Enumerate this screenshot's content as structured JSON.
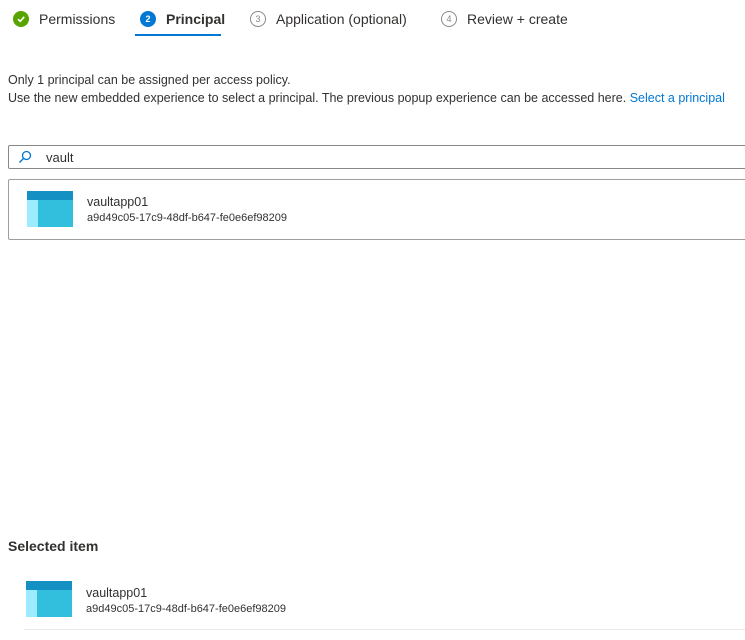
{
  "wizard": {
    "steps": [
      {
        "number": "",
        "label": "Permissions",
        "state": "completed",
        "icon": "checkmark-icon"
      },
      {
        "number": "2",
        "label": "Principal",
        "state": "active"
      },
      {
        "number": "3",
        "label": "Application (optional)",
        "state": "pending"
      },
      {
        "number": "4",
        "label": "Review + create",
        "state": "pending"
      }
    ]
  },
  "info": {
    "line1": "Only 1 principal can be assigned per access policy.",
    "line2": "Use the new embedded experience to select a principal. The previous popup experience can be accessed here.",
    "link": "Select a principal"
  },
  "search": {
    "value": "vault",
    "icon": "search-icon"
  },
  "results": [
    {
      "name": "vaultapp01",
      "id": "a9d49c05-17c9-48df-b647-fe0e6ef98209",
      "icon": "app-registration-icon"
    }
  ],
  "selected": {
    "heading": "Selected item",
    "items": [
      {
        "name": "vaultapp01",
        "id": "a9d49c05-17c9-48df-b647-fe0e6ef98209",
        "icon": "app-registration-icon"
      }
    ]
  },
  "colors": {
    "accent": "#0078d4",
    "completed": "#57a300",
    "app_icon_dark": "#1490c2",
    "app_icon_mid": "#32bedd",
    "app_icon_light": "#9cebff"
  }
}
